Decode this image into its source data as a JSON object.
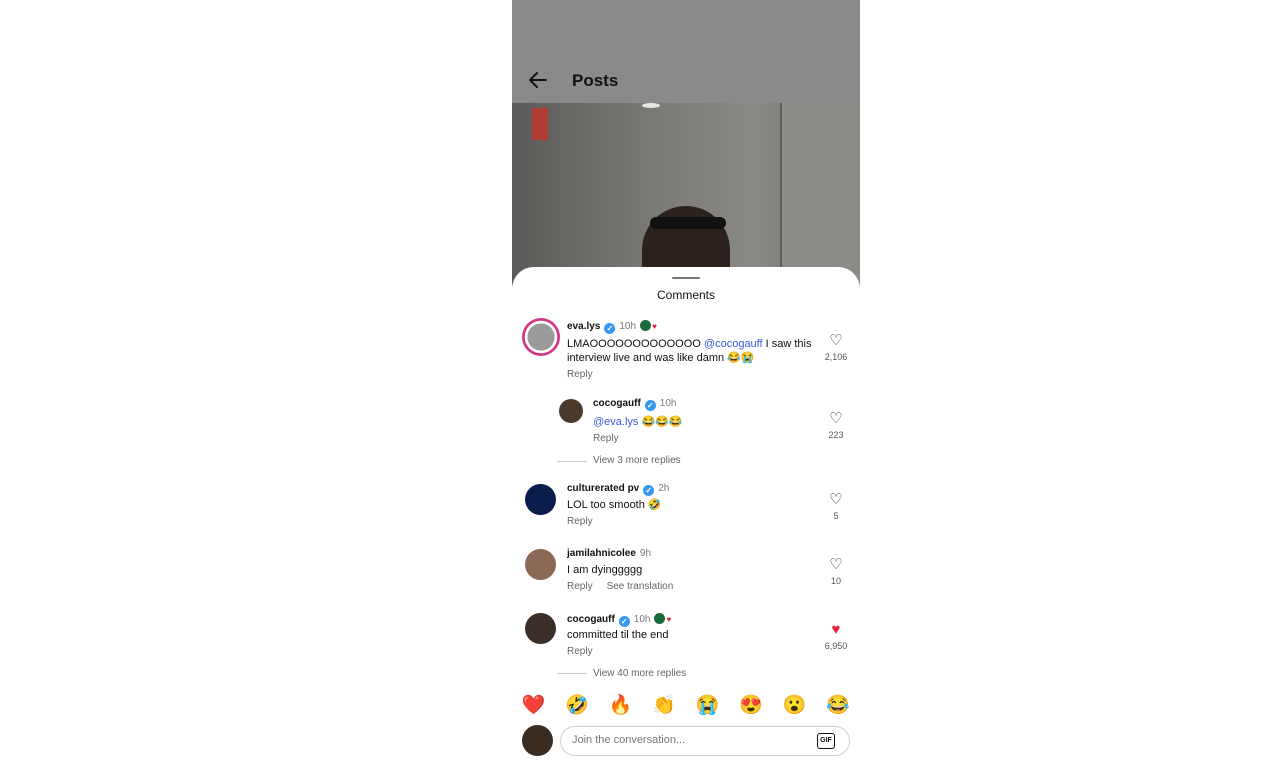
{
  "header": {
    "title": "Posts"
  },
  "sheet": {
    "title": "Comments"
  },
  "comments": [
    {
      "username": "eva.lys",
      "time": "10h",
      "text_plain": "LMAOOOOOOOOOOOOO",
      "mention": "@cocogauff",
      "text_after": " I saw this interview live and was like damn 😂😭",
      "reply": "Reply",
      "likes": "2,106"
    },
    {
      "username": "cocogauff",
      "time": "10h",
      "mention": "@eva.lys",
      "text_after": " 😂😂😂",
      "reply": "Reply",
      "likes": "223",
      "view_more": "View 3 more replies"
    },
    {
      "username": "culturerated pv",
      "time": "2h",
      "text": "LOL too smooth 🤣",
      "reply": "Reply",
      "likes": "5"
    },
    {
      "username": "jamilahnicolee",
      "time": "9h",
      "text": "I am dyinggggg",
      "reply": "Reply",
      "see_translation": "See translation",
      "likes": "10"
    },
    {
      "username": "cocogauff",
      "time": "10h",
      "text": "committed til the end",
      "reply": "Reply",
      "likes": "6,950",
      "view_more": "View 40 more replies"
    }
  ],
  "reactions": [
    "❤️",
    "🤣",
    "🔥",
    "👏",
    "😭",
    "😍",
    "😮",
    "😂"
  ],
  "composer": {
    "placeholder": "Join the conversation...",
    "gif_label": "GIF"
  },
  "colors": {
    "mention": "#3a5ad9",
    "liked_heart": "#e0243b",
    "verified": "#3897f0"
  }
}
